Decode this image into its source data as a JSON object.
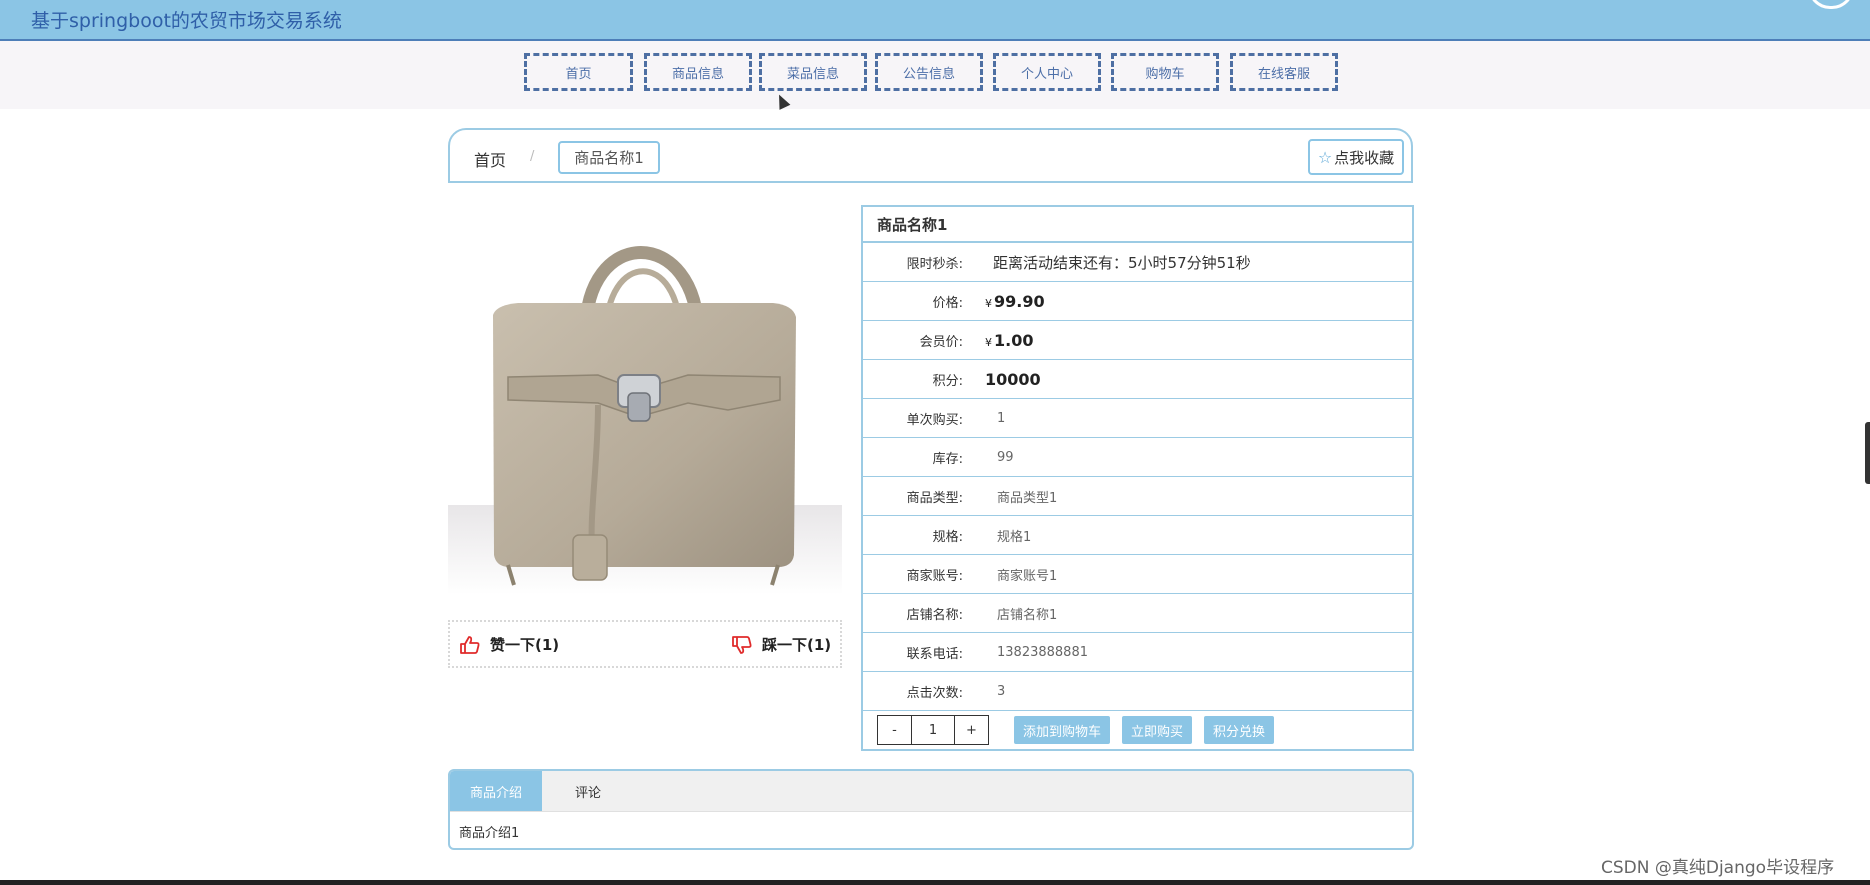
{
  "header": {
    "title": "基于springboot的农贸市场交易系统"
  },
  "nav": {
    "items": [
      "首页",
      "商品信息",
      "菜品信息",
      "公告信息",
      "个人中心",
      "购物车",
      "在线客服"
    ]
  },
  "breadcrumb": {
    "home": "首页",
    "separator": "/",
    "current": "商品名称1"
  },
  "favorite": {
    "label": "点我收藏",
    "icon": "star-outline-icon"
  },
  "votes": {
    "like_label": "赞一下(1)",
    "dislike_label": "踩一下(1)"
  },
  "product": {
    "name": "商品名称1",
    "rows": [
      {
        "label": "限时秒杀:",
        "value": "距离活动结束还有：5小时57分钟51秒"
      },
      {
        "label": "价格:",
        "currency": "¥",
        "value": "99.90"
      },
      {
        "label": "会员价:",
        "currency": "¥",
        "value": "1.00"
      },
      {
        "label": "积分:",
        "value": "10000"
      },
      {
        "label": "单次购买:",
        "value": "1"
      },
      {
        "label": "库存:",
        "value": "99"
      },
      {
        "label": "商品类型:",
        "value": "商品类型1"
      },
      {
        "label": "规格:",
        "value": "规格1"
      },
      {
        "label": "商家账号:",
        "value": "商家账号1"
      },
      {
        "label": "店铺名称:",
        "value": "店铺名称1"
      },
      {
        "label": "联系电话:",
        "value": "13823888881"
      },
      {
        "label": "点击次数:",
        "value": "3"
      }
    ]
  },
  "actions": {
    "minus": "-",
    "quantity": "1",
    "plus": "+",
    "add_to_cart": "添加到购物车",
    "buy_now": "立即购买",
    "redeem_points": "积分兑换"
  },
  "tabs": {
    "items": [
      "商品介绍",
      "评论"
    ],
    "active_index": 0,
    "content": "商品介绍1"
  },
  "watermark": "CSDN @真纯Django毕设程序",
  "colors": {
    "accent": "#8bc5e5",
    "nav_border": "#4e6fa3",
    "header_text": "#2f5fa8",
    "table_border": "#9ccbe4"
  }
}
